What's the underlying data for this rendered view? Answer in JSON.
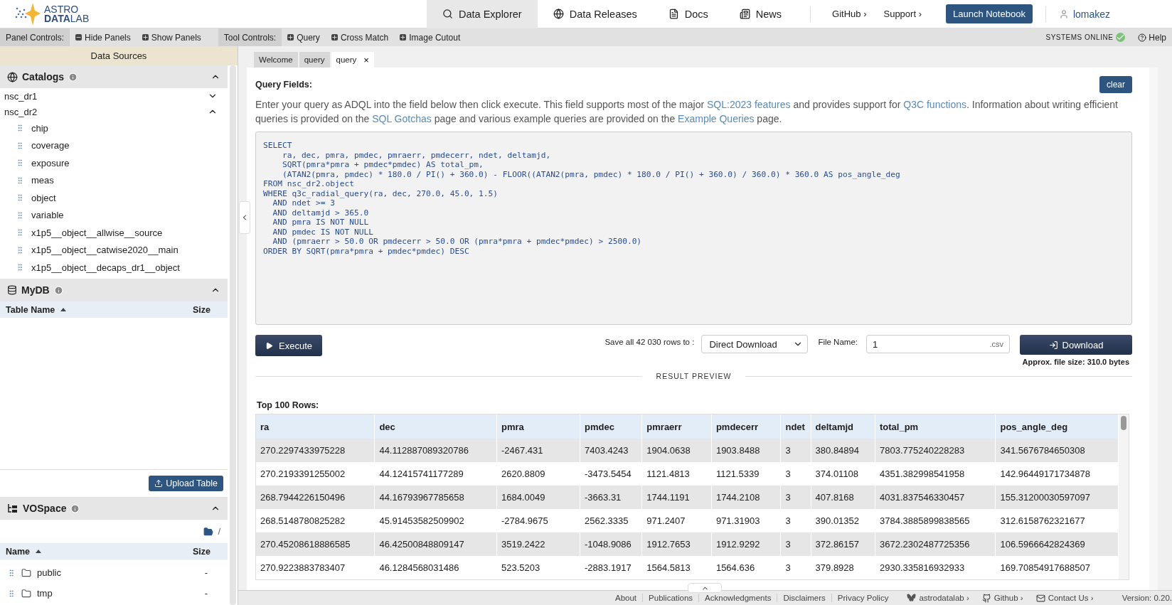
{
  "header": {
    "logo_title": "ASTRO",
    "logo_subtitle": "**DATA**LAB",
    "nav": [
      {
        "label": "Data Explorer",
        "kind": "search",
        "selected": true
      },
      {
        "label": "Data Releases",
        "kind": "globe",
        "selected": false
      },
      {
        "label": "Docs",
        "kind": "doc",
        "selected": false
      },
      {
        "label": "News",
        "kind": "news",
        "selected": false
      }
    ],
    "links": [
      "GitHub ›",
      "Support ›"
    ],
    "cta": "Launch Notebook",
    "user": "lomakez"
  },
  "toolbar": {
    "panel_label": "Panel Controls:",
    "panel_buttons": [
      "Hide Panels",
      "Show Panels"
    ],
    "tool_label": "Tool Controls:",
    "tool_buttons": [
      "Query",
      "Cross Match",
      "Image Cutout"
    ],
    "status": "SYSTEMS ONLINE",
    "help": "Help"
  },
  "sidebar": {
    "title": "Data Sources",
    "catalogs": {
      "title": "Catalogs",
      "expanded": true,
      "items": [
        {
          "label": "nsc_dr1",
          "expanded": false
        },
        {
          "label": "nsc_dr2",
          "expanded": true,
          "children": [
            "chip",
            "coverage",
            "exposure",
            "meas",
            "object",
            "variable",
            "x1p5__object__allwise__source",
            "x1p5__object__catwise2020__main",
            "x1p5__object__decaps_dr1__object"
          ]
        }
      ]
    },
    "mydb": {
      "title": "MyDB",
      "expanded": true,
      "columns": [
        "Table Name",
        "Size"
      ],
      "upload": "Upload Table"
    },
    "vospace": {
      "title": "VOSpace",
      "expanded": true,
      "path": "/",
      "columns": [
        "Name",
        "Size"
      ],
      "rows": [
        {
          "name": "public",
          "size": "-"
        },
        {
          "name": "tmp",
          "size": "-"
        }
      ]
    }
  },
  "tabs": [
    {
      "label": "Welcome",
      "selected": false
    },
    {
      "label": "query",
      "selected": false
    },
    {
      "label": "query",
      "selected": true,
      "close": "×"
    }
  ],
  "query": {
    "title": "Query Fields:",
    "clear": "clear",
    "description": [
      {
        "kind": "text",
        "text": "Enter your query as ADQL into the field below then click execute. This field supports most of the major "
      },
      {
        "kind": "link",
        "text": "SQL:2023 features"
      },
      {
        "kind": "text",
        "text": " and provides support for "
      },
      {
        "kind": "link",
        "text": "Q3C functions"
      },
      {
        "kind": "text",
        "text": ". Information about writing efficient queries is provided on the "
      },
      {
        "kind": "link",
        "text": "SQL Gotchas"
      },
      {
        "kind": "text",
        "text": " page and various example queries are provided on the "
      },
      {
        "kind": "link",
        "text": "Example Queries"
      },
      {
        "kind": "text",
        "text": " page."
      }
    ],
    "sql": "SELECT\n    ra, dec, pmra, pmdec, pmraerr, pmdecerr, ndet, deltamjd,\n    SQRT(pmra*pmra + pmdec*pmdec) AS total_pm,\n    (ATAN2(pmra, pmdec) * 180.0 / PI() + 360.0) - FLOOR((ATAN2(pmra, pmdec) * 180.0 / PI() + 360.0) / 360.0) * 360.0 AS pos_angle_deg\nFROM nsc_dr2.object\nWHERE q3c_radial_query(ra, dec, 270.0, 45.0, 1.5)\n  AND ndet >= 3\n  AND deltamjd > 365.0\n  AND pmra IS NOT NULL\n  AND pmdec IS NOT NULL\n  AND (pmraerr > 50.0 OR pmdecerr > 50.0 OR (pmra*pmra + pmdec*pmdec) > 2500.0)\nORDER BY SQRT(pmra*pmra + pmdec*pmdec) DESC",
    "execute": "Execute",
    "save_label": "Save all 42 030 rows to :",
    "destination": "Direct Download",
    "file_name_label": "File Name:",
    "file_name": "1",
    "extension": ".csv",
    "download": "Download",
    "file_size": "Approx. file size: 310.0 bytes"
  },
  "results": {
    "divider": "RESULT PREVIEW",
    "title": "Top 100 Rows:",
    "columns": [
      "ra",
      "dec",
      "pmra",
      "pmdec",
      "pmraerr",
      "pmdecerr",
      "ndet",
      "deltamjd",
      "total_pm",
      "pos_angle_deg"
    ],
    "rows": [
      [
        "270.2297433975228",
        "44.112887089320786",
        "-2467.431",
        "7403.4243",
        "1904.0638",
        "1903.8488",
        "3",
        "380.84894",
        "7803.775240228283",
        "341.5676784650308"
      ],
      [
        "270.2193391255002",
        "44.12415741177289",
        "2620.8809",
        "-3473.5454",
        "1121.4813",
        "1121.5339",
        "3",
        "374.01108",
        "4351.382998541958",
        "142.96449171734878"
      ],
      [
        "268.7944226150496",
        "44.16793967785658",
        "1684.0049",
        "-3663.31",
        "1744.1191",
        "1744.2108",
        "3",
        "407.8168",
        "4031.837546330457",
        "155.31200030597097"
      ],
      [
        "268.5148780825282",
        "45.91453582509902",
        "-2784.9675",
        "2562.3335",
        "971.2407",
        "971.31903",
        "3",
        "390.01352",
        "3784.3885899838565",
        "312.6158762321677"
      ],
      [
        "270.45208618886585",
        "46.42500848809147",
        "3519.2422",
        "-1048.9086",
        "1912.7653",
        "1912.9292",
        "3",
        "372.86157",
        "3672.2302487725356",
        "106.5966642824369"
      ],
      [
        "270.9223883783407",
        "46.1284568031486",
        "523.5203",
        "-2883.1917",
        "1564.5813",
        "1564.636",
        "3",
        "379.8928",
        "2930.335816932933",
        "169.70854917688507"
      ]
    ]
  },
  "footer": {
    "links": [
      "About",
      "Publications",
      "Acknowledgments",
      "Disclaimers",
      "Privacy Policy"
    ],
    "social": [
      {
        "label": "astrodatalab ›",
        "kind": "butterfly"
      },
      {
        "label": "Github ›",
        "kind": "github"
      },
      {
        "label": "Contact Us ›",
        "kind": "mail"
      }
    ],
    "version": "Version: 0.20."
  }
}
